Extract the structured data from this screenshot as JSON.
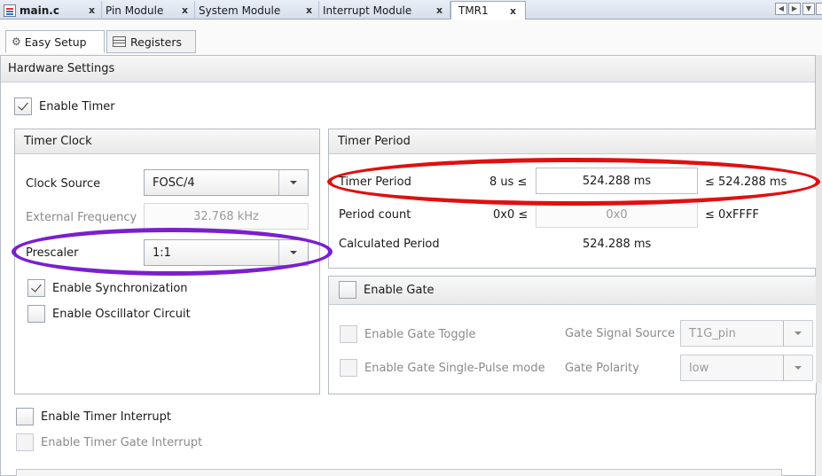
{
  "tabs": [
    {
      "label": "main.c"
    },
    {
      "label": "Pin Module"
    },
    {
      "label": "System Module"
    },
    {
      "label": "Interrupt Module"
    },
    {
      "label": "TMR1"
    }
  ],
  "tab_close": "x",
  "subtabs": {
    "easy_setup": "Easy Setup",
    "registers": "Registers"
  },
  "hardware_settings": {
    "title": "Hardware Settings",
    "enable_timer": {
      "label": "Enable Timer",
      "checked": true
    }
  },
  "timer_clock": {
    "title": "Timer Clock",
    "clock_source_label": "Clock Source",
    "clock_source_value": "FOSC/4",
    "external_frequency_label": "External Frequency",
    "external_frequency_value": "32.768 kHz",
    "prescaler_label": "Prescaler",
    "prescaler_value": "1:1",
    "enable_synchronization": {
      "label": "Enable Synchronization",
      "checked": true
    },
    "enable_oscillator_circuit": {
      "label": "Enable Oscillator Circuit",
      "checked": false
    }
  },
  "timer_period": {
    "title": "Timer Period",
    "timer_period_label": "Timer Period",
    "timer_period_min": "8 us ≤",
    "timer_period_value": "524.288 ms",
    "timer_period_max": "≤ 524.288 ms",
    "period_count_label": "Period count",
    "period_count_min": "0x0 ≤",
    "period_count_value": "0x0",
    "period_count_max": "≤ 0xFFFF",
    "calculated_period_label": "Calculated Period",
    "calculated_period_value": "524.288 ms"
  },
  "gate": {
    "enable_gate": {
      "label": "Enable Gate",
      "checked": false
    },
    "enable_gate_toggle": {
      "label": "Enable Gate Toggle",
      "checked": false
    },
    "enable_gate_single_pulse": {
      "label": "Enable Gate Single-Pulse mode",
      "checked": false
    },
    "gate_signal_source_label": "Gate Signal Source",
    "gate_signal_source_value": "T1G_pin",
    "gate_polarity_label": "Gate Polarity",
    "gate_polarity_value": "low"
  },
  "interrupts": {
    "enable_timer_interrupt": {
      "label": "Enable Timer Interrupt",
      "checked": false
    },
    "enable_timer_gate_interrupt": {
      "label": "Enable Timer Gate Interrupt",
      "checked": false
    }
  },
  "annotations": {
    "red_color": "#e01010",
    "purple_color": "#7a1fd0"
  },
  "icons": [
    "file-c-icon",
    "gear-icon",
    "registers-icon",
    "nav-left-icon",
    "nav-right-icon",
    "nav-menu-icon",
    "dropdown-arrow-icon",
    "checkmark-icon"
  ]
}
